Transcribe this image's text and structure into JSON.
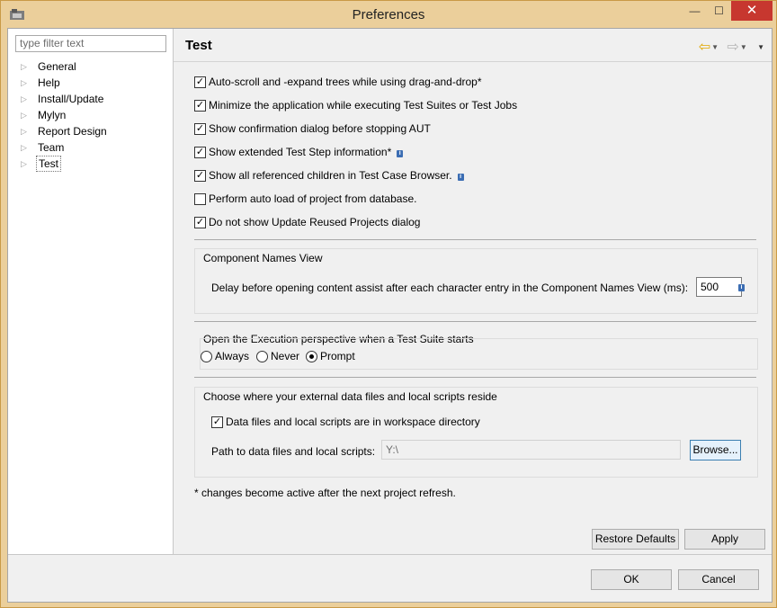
{
  "window": {
    "title": "Preferences",
    "close_glyph": "✕",
    "min_glyph": "—",
    "max_glyph": "☐"
  },
  "left": {
    "filter_placeholder": "type filter text",
    "tree": [
      {
        "label": "General"
      },
      {
        "label": "Help"
      },
      {
        "label": "Install/Update"
      },
      {
        "label": "Mylyn"
      },
      {
        "label": "Report Design"
      },
      {
        "label": "Team"
      },
      {
        "label": "Test",
        "selected": true
      }
    ]
  },
  "page": {
    "title": "Test",
    "checkboxes": [
      {
        "label": "Auto-scroll and -expand trees while using drag-and-drop*",
        "checked": true,
        "info": false
      },
      {
        "label": "Minimize the application while executing Test Suites or Test Jobs",
        "checked": true,
        "info": false
      },
      {
        "label": "Show confirmation dialog before stopping AUT",
        "checked": true,
        "info": false
      },
      {
        "label": "Show extended Test Step information*",
        "checked": true,
        "info": true
      },
      {
        "label": "Show all referenced children in Test Case Browser.",
        "checked": true,
        "info": true
      },
      {
        "label": "Perform auto load of project from database.",
        "checked": false,
        "info": false
      },
      {
        "label": "Do not show Update Reused Projects dialog",
        "checked": true,
        "info": false
      }
    ],
    "component_names": {
      "title": "Component Names View",
      "delay_label": "Delay before opening content assist after each character entry in the Component Names View (ms):",
      "delay_value": "500"
    },
    "execution": {
      "title": "Open the Execution perspective when a Test Suite starts",
      "options": [
        "Always",
        "Never",
        "Prompt"
      ],
      "selected": "Prompt"
    },
    "data_files": {
      "title": "Choose where your external data files and local scripts reside",
      "workspace_checkbox": "Data files and local scripts are in workspace directory",
      "workspace_checked": true,
      "path_label": "Path to data files and local scripts:",
      "path_value": "Y:\\",
      "browse_label": "Browse..."
    },
    "footnote": "* changes become active after the next project refresh.",
    "restore_label": "Restore Defaults",
    "apply_label": "Apply"
  },
  "dialog": {
    "ok_label": "OK",
    "cancel_label": "Cancel"
  },
  "colors": {
    "titlebar": "#ebcf9b",
    "close": "#c7372f",
    "back_arrow": "#e0a800",
    "info": "#3b6db3"
  },
  "icons": {
    "back": "back-arrow-icon",
    "forward": "forward-arrow-icon",
    "menu": "view-menu-icon",
    "info": "info-icon",
    "expand": "tree-expand-icon"
  }
}
